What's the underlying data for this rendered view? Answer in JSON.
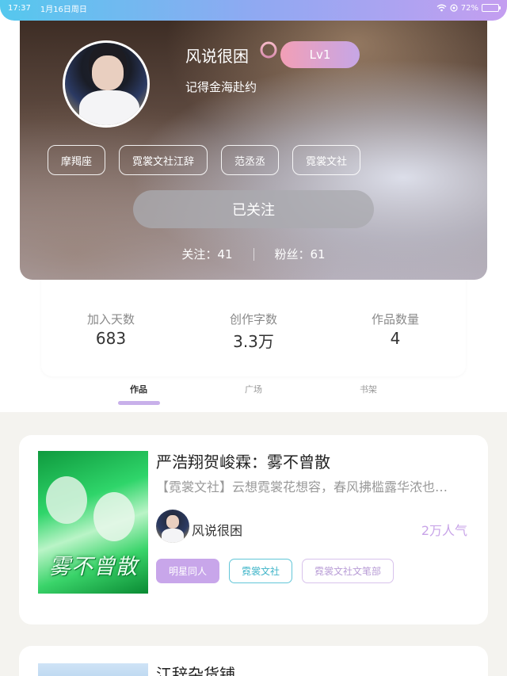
{
  "status_bar": {
    "time": "17:37",
    "date": "1月16日周日",
    "battery": "72%",
    "battery_level": 0.72
  },
  "profile": {
    "username": "风说很困",
    "gender_icon": "female-icon",
    "level": "Lv1",
    "signature": "记得金海赴约",
    "tags": [
      "摩羯座",
      "霓裳文社江辞",
      "范丞丞",
      "霓裳文社"
    ],
    "follow_button": "已关注",
    "following": "关注：41",
    "followers": "粉丝：61"
  },
  "stats": [
    {
      "label": "加入天数",
      "value": "683"
    },
    {
      "label": "创作字数",
      "value": "3.3万"
    },
    {
      "label": "作品数量",
      "value": "4"
    }
  ],
  "tabs": [
    {
      "label": "作品",
      "active": true
    },
    {
      "label": "广场",
      "active": false
    },
    {
      "label": "书架",
      "active": false
    }
  ],
  "works": [
    {
      "title": "严浩翔贺峻霖：雾不曾散",
      "description": "【霓裳文社】云想霓裳花想容，春风拂槛露华浓也…",
      "author": "风说很困",
      "popularity": "2万人气",
      "cover_text": "雾不曾散",
      "tags": [
        "明星同人",
        "霓裳文社",
        "霓裳文社文笔部"
      ]
    },
    {
      "title": "江辞杂货铺"
    }
  ],
  "colors": {
    "accent": "#c8a6ea",
    "cyan_tag": "#62c6d8",
    "level_badge_start": "#f29fb6",
    "level_badge_end": "#c6a6e6"
  }
}
